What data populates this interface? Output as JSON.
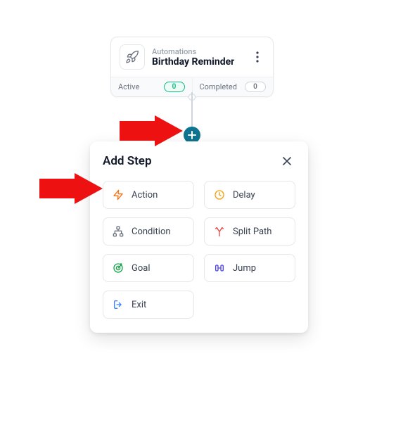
{
  "node": {
    "subtitle": "Automations",
    "title": "Birthday Reminder",
    "stats": {
      "active_label": "Active",
      "active_count": "0",
      "completed_label": "Completed",
      "completed_count": "0"
    }
  },
  "plus_label": "+",
  "modal": {
    "title": "Add Step",
    "steps": {
      "action": "Action",
      "delay": "Delay",
      "condition": "Condition",
      "split": "Split Path",
      "goal": "Goal",
      "jump": "Jump",
      "exit": "Exit"
    }
  }
}
